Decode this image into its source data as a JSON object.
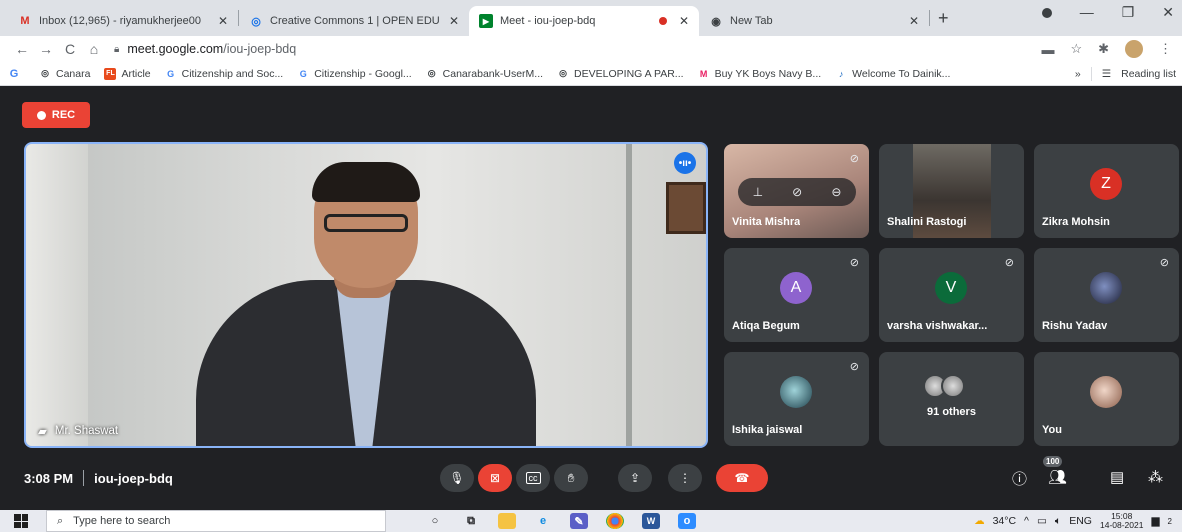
{
  "browser": {
    "tabs": [
      {
        "title": "Inbox (12,965) - riyamukherjee00",
        "icon": "gmail-icon",
        "color": "#d93025",
        "active": false
      },
      {
        "title": "Creative Commons 1 | OPEN EDU",
        "icon": "globe-icon",
        "color": "#1a73e8",
        "active": false
      },
      {
        "title": "Meet - iou-joep-bdq",
        "icon": "meet-icon",
        "color": "#00832d",
        "active": true,
        "recording": true
      },
      {
        "title": "New Tab",
        "icon": "chrome-icon",
        "color": "#3c4043",
        "active": false
      }
    ],
    "url_host": "meet.google.com",
    "url_path": "/iou-joep-bdq",
    "bookmarks": [
      {
        "label": "Canara",
        "icon": "globe-icon"
      },
      {
        "label": "Article",
        "icon": "fl-icon"
      },
      {
        "label": "Citizenship and Soc...",
        "icon": "google-icon"
      },
      {
        "label": "Citizenship - Googl...",
        "icon": "google-icon"
      },
      {
        "label": "Canarabank-UserM...",
        "icon": "globe-icon"
      },
      {
        "label": "DEVELOPING A PAR...",
        "icon": "globe-icon"
      },
      {
        "label": "Buy YK Boys Navy B...",
        "icon": "myntra-icon"
      },
      {
        "label": "Welcome To Dainik...",
        "icon": "dainik-icon"
      }
    ],
    "reading_list": "Reading list",
    "overflow": "»"
  },
  "meet": {
    "rec_label": "REC",
    "main_speaker": "Mr. Shaswat",
    "meeting_time": "3:08 PM",
    "meeting_code": "iou-joep-bdq",
    "participant_count": "100",
    "tiles": [
      {
        "name": "Vinita Mishra",
        "type": "video"
      },
      {
        "name": "Shalini Rastogi",
        "type": "video"
      },
      {
        "name": "Zikra Mohsin",
        "type": "avatar",
        "initial": "Z",
        "color": "#d93025"
      },
      {
        "name": "Atiqa Begum",
        "type": "avatar",
        "initial": "A",
        "color": "#8e63ce"
      },
      {
        "name": "varsha vishwakar...",
        "type": "avatar",
        "initial": "V",
        "color": "#0b6b3a"
      },
      {
        "name": "Rishu Yadav",
        "type": "photo"
      },
      {
        "name": "Ishika jaiswal",
        "type": "photo"
      },
      {
        "name": "91 others",
        "type": "others"
      },
      {
        "name": "You",
        "type": "photo"
      }
    ]
  },
  "taskbar": {
    "search_placeholder": "Type here to search",
    "weather": "34°C",
    "language": "ENG",
    "time": "15:08",
    "date": "14-08-2021",
    "notification_count": "2"
  }
}
